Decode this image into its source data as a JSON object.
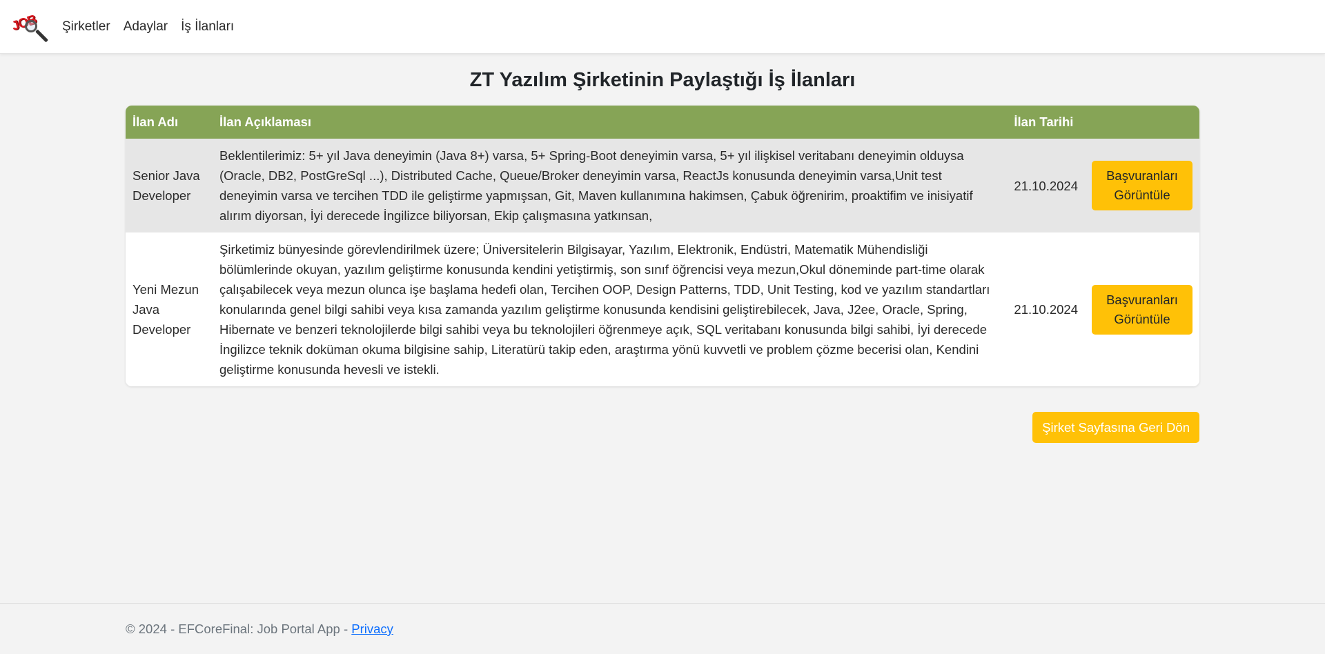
{
  "brand": {
    "logo_text": "JOB"
  },
  "nav": {
    "items": [
      {
        "label": "Şirketler"
      },
      {
        "label": "Adaylar"
      },
      {
        "label": "İş İlanları"
      }
    ]
  },
  "page": {
    "title": "ZT Yazılım Şirketinin Paylaştığı İş İlanları"
  },
  "table": {
    "headers": {
      "name": "İlan Adı",
      "description": "İlan Açıklaması",
      "date": "İlan Tarihi",
      "action": ""
    },
    "rows": [
      {
        "name": "Senior Java Developer",
        "description": "Beklentilerimiz: 5+ yıl Java deneyimin (Java 8+) varsa, 5+ Spring-Boot deneyimin varsa, 5+ yıl ilişkisel veritabanı deneyimin olduysa (Oracle, DB2, PostGreSql ...), Distributed Cache, Queue/Broker deneyimin varsa, ReactJs konusunda deneyimin varsa,Unit test deneyimin varsa ve tercihen TDD ile geliştirme yapmışsan, Git, Maven kullanımına hakimsen, Çabuk öğrenirim, proaktifim ve inisiyatif alırım diyorsan, İyi derecede İngilizce biliyorsan, Ekip çalışmasına yatkınsan,",
        "date": "21.10.2024",
        "button": "Başvuranları Görüntüle"
      },
      {
        "name": "Yeni Mezun Java Developer",
        "description": "Şirketimiz bünyesinde görevlendirilmek üzere; Üniversitelerin Bilgisayar, Yazılım, Elektronik, Endüstri, Matematik Mühendisliği bölümlerinde okuyan, yazılım geliştirme konusunda kendini yetiştirmiş, son sınıf öğrencisi veya mezun,Okul döneminde part-time olarak çalışabilecek veya mezun olunca işe başlama hedefi olan, Tercihen OOP, Design Patterns, TDD, Unit Testing, kod ve yazılım standartları konularında genel bilgi sahibi veya kısa zamanda yazılım geliştirme konusunda kendisini geliştirebilecek, Java, J2ee, Oracle, Spring, Hibernate ve benzeri teknolojilerde bilgi sahibi veya bu teknolojileri öğrenmeye açık, SQL veritabanı konusunda bilgi sahibi, İyi derecede İngilizce teknik doküman okuma bilgisine sahip, Literatürü takip eden, araştırma yönü kuvvetli ve problem çözme becerisi olan, Kendini geliştirme konusunda hevesli ve istekli.",
        "date": "21.10.2024",
        "button": "Başvuranları Görüntüle"
      }
    ]
  },
  "back_button": {
    "label": "Şirket Sayfasına Geri Dön"
  },
  "footer": {
    "text": "© 2024 - EFCoreFinal: Job Portal App - ",
    "privacy_label": "Privacy"
  },
  "colors": {
    "header_bg": "#86a456",
    "button_bg": "#ffc107",
    "odd_row_bg": "#e6e6e6",
    "link": "#0d6efd"
  }
}
